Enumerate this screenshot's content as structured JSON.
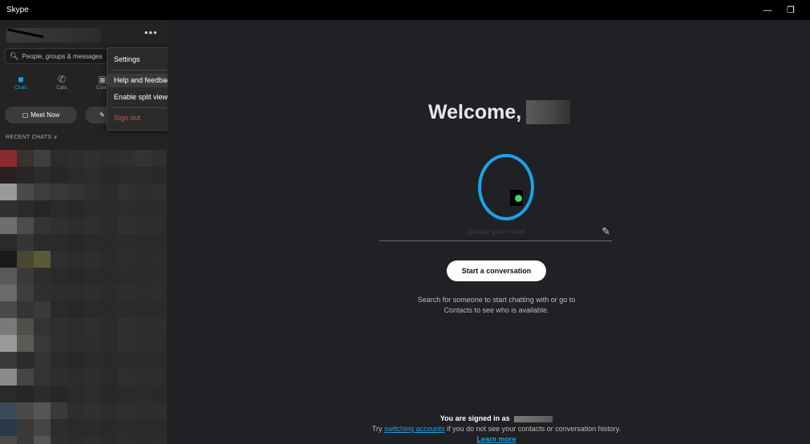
{
  "window": {
    "title": "Skype",
    "minimize_glyph": "—",
    "restore_glyph": "❐"
  },
  "sidebar": {
    "more_label": "•••",
    "search_placeholder": "People, groups & messages",
    "nav": [
      {
        "label": "Chats",
        "icon": "chat-icon"
      },
      {
        "label": "Calls",
        "icon": "phone-icon"
      },
      {
        "label": "Conta",
        "icon": "contacts-icon"
      }
    ],
    "meet_now_label": "Meet Now",
    "recent_chats_label": "RECENT CHATS"
  },
  "menu": {
    "items": [
      {
        "label": "Settings"
      },
      {
        "label": "Help and feedback"
      },
      {
        "label": "Enable split view mode"
      },
      {
        "label": "Sign out"
      }
    ]
  },
  "main": {
    "welcome": "Welcome,",
    "mood_placeholder": "Update your mood",
    "start_button": "Start a conversation",
    "hint_line1": "Search for someone to start chatting with or go to",
    "hint_line2": "Contacts to see who is available.",
    "signed_in_prefix": "You are signed in as",
    "try_prefix": "Try",
    "switching_accounts": "switching accounts",
    "try_suffix": "if you do not see your contacts or conversation history.",
    "learn_more": "Learn more"
  },
  "colors": {
    "accent": "#1aa3e8",
    "presence": "#4bd35a",
    "danger": "#e0503c"
  }
}
